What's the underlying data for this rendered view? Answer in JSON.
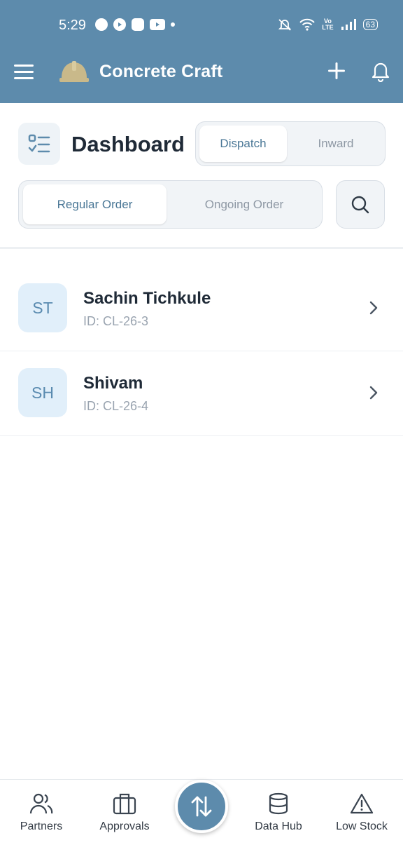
{
  "status_bar": {
    "time": "5:29",
    "battery": "63"
  },
  "app_bar": {
    "title": "Concrete Craft",
    "icons": [
      "menu-icon",
      "helmet-logo-icon",
      "plus-icon",
      "bell-icon"
    ],
    "background": "#5d8bac",
    "logo_color": "#c9b98a"
  },
  "header": {
    "title": "Dashboard",
    "flow_tabs": [
      {
        "label": "Dispatch",
        "active": true
      },
      {
        "label": "Inward",
        "active": false
      }
    ],
    "order_tabs": [
      {
        "label": "Regular Order",
        "active": true
      },
      {
        "label": "Ongoing Order",
        "active": false
      }
    ]
  },
  "list": [
    {
      "initials": "ST",
      "name": "Sachin Tichkule",
      "id": "ID: CL-26-3"
    },
    {
      "initials": "SH",
      "name": "Shivam",
      "id": "ID: CL-26-4"
    }
  ],
  "bottom_nav": {
    "items": [
      {
        "label": "Partners",
        "icon": "users-icon"
      },
      {
        "label": "Approvals",
        "icon": "briefcase-icon"
      },
      {
        "label": "Data Hub",
        "icon": "database-icon"
      },
      {
        "label": "Low Stock",
        "icon": "warning-icon"
      }
    ],
    "fab_icon": "swap-vertical-icon"
  },
  "colors": {
    "primary": "#5d8bac",
    "avatar_bg": "#e1effa",
    "avatar_text": "#5a8bb0",
    "active_tab_text": "#4a7796"
  }
}
